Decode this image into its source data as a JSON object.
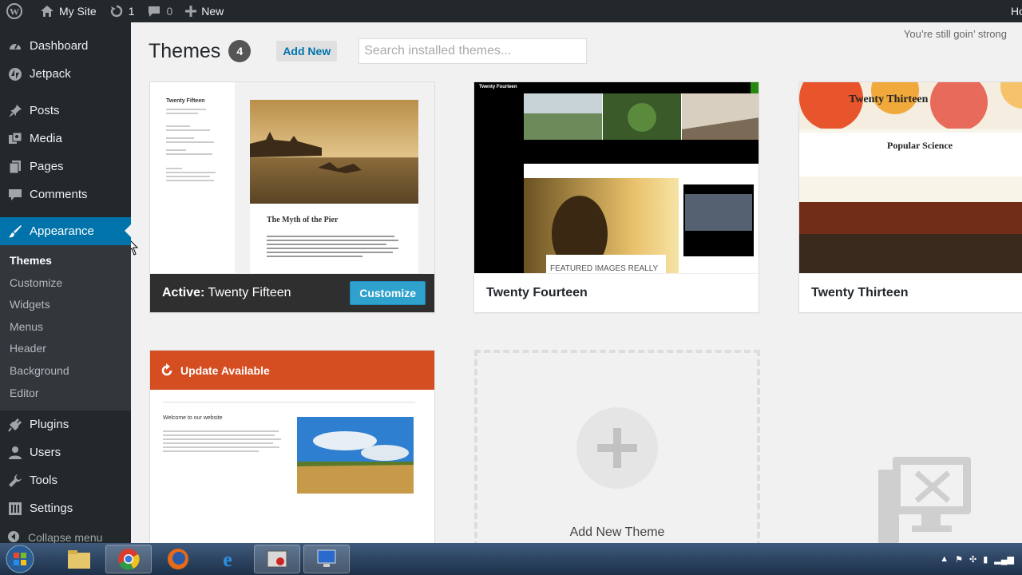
{
  "adminbar": {
    "site_name": "My Site",
    "updates_count": "1",
    "comments_count": "0",
    "new_label": "New",
    "right_text": "Howdy"
  },
  "sidebar": {
    "items": [
      {
        "label": "Dashboard",
        "icon": "dashboard-icon"
      },
      {
        "label": "Jetpack",
        "icon": "jetpack-icon"
      },
      {
        "label": "Posts",
        "icon": "pin-icon"
      },
      {
        "label": "Media",
        "icon": "media-icon"
      },
      {
        "label": "Pages",
        "icon": "pages-icon"
      },
      {
        "label": "Comments",
        "icon": "comment-icon"
      },
      {
        "label": "Appearance",
        "icon": "brush-icon"
      },
      {
        "label": "Plugins",
        "icon": "plugin-icon"
      },
      {
        "label": "Users",
        "icon": "user-icon"
      },
      {
        "label": "Tools",
        "icon": "wrench-icon"
      },
      {
        "label": "Settings",
        "icon": "settings-icon"
      }
    ],
    "submenu": [
      "Themes",
      "Customize",
      "Widgets",
      "Menus",
      "Header",
      "Background",
      "Editor"
    ],
    "collapse_label": "Collapse menu"
  },
  "main": {
    "title": "Themes",
    "count": "4",
    "add_new": "Add New",
    "search_placeholder": "Search installed themes...",
    "tagline": "You’re still goin’ strong"
  },
  "themes": {
    "active": {
      "prefix": "Active:",
      "name": "Twenty Fifteen",
      "customize": "Customize",
      "post_title": "The Myth of the Pier",
      "site_title": "Twenty Fifteen"
    },
    "fourteen": {
      "name": "Twenty Fourteen",
      "site_title": "Twenty Fourteen",
      "caption": "FEATURED IMAGES REALLY"
    },
    "thirteen": {
      "name": "Twenty Thirteen",
      "site_title": "Twenty Thirteen",
      "post_title": "Popular Science"
    },
    "update": {
      "label": "Update Available",
      "heading": "Welcome to our website"
    },
    "add_new_theme": "Add New Theme"
  },
  "colors": {
    "admin_dark": "#23282d",
    "accent_blue": "#0073aa",
    "update_orange": "#d54e21"
  }
}
